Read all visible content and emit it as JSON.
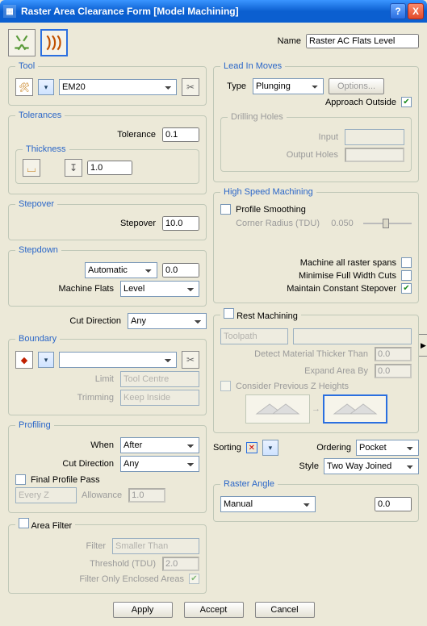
{
  "window": {
    "title": "Raster Area Clearance Form [Model Machining]",
    "help": "?",
    "close": "X"
  },
  "name": {
    "label": "Name",
    "value": "Raster AC Flats Level"
  },
  "tool": {
    "legend": "Tool",
    "value": "EM20"
  },
  "tolerances": {
    "legend": "Tolerances",
    "tolerance_label": "Tolerance",
    "tolerance_value": "0.1",
    "thickness_legend": "Thickness",
    "thickness_value": "1.0"
  },
  "stepover": {
    "legend": "Stepover",
    "label": "Stepover",
    "value": "10.0"
  },
  "stepdown": {
    "legend": "Stepdown",
    "mode": "Automatic",
    "value": "0.0",
    "mflats_label": "Machine Flats",
    "mflats_value": "Level"
  },
  "cutdir": {
    "label": "Cut Direction",
    "value": "Any"
  },
  "boundary": {
    "legend": "Boundary",
    "value": "",
    "limit_label": "Limit",
    "limit_value": "Tool Centre",
    "trim_label": "Trimming",
    "trim_value": "Keep Inside"
  },
  "profiling": {
    "legend": "Profiling",
    "when_label": "When",
    "when_value": "After",
    "cutdir_label": "Cut Direction",
    "cutdir_value": "Any",
    "final_label": "Final Profile Pass",
    "every_value": "Every Z",
    "allow_label": "Allowance",
    "allow_value": "1.0"
  },
  "areafilter": {
    "legend": "Area Filter",
    "filter_label": "Filter",
    "filter_value": "Smaller Than",
    "thresh_label": "Threshold (TDU)",
    "thresh_value": "2.0",
    "enclosed_label": "Filter Only Enclosed Areas"
  },
  "leadin": {
    "legend": "Lead In Moves",
    "type_label": "Type",
    "type_value": "Plunging",
    "options_label": "Options...",
    "approach_label": "Approach Outside",
    "drill_legend": "Drilling Holes",
    "input_label": "Input",
    "output_label": "Output Holes"
  },
  "hsm": {
    "legend": "High Speed Machining",
    "prof_label": "Profile Smoothing",
    "corner_label": "Corner Radius (TDU)",
    "corner_value": "0.050",
    "mall_label": "Machine all raster spans",
    "minfull_label": "Minimise Full Width Cuts",
    "maint_label": "Maintain Constant Stepover"
  },
  "rest": {
    "legend": "Rest Machining",
    "tp_label": "Toolpath",
    "detect_label": "Detect Material Thicker Than",
    "detect_value": "0.0",
    "expand_label": "Expand Area By",
    "expand_value": "0.0",
    "consider_label": "Consider Previous Z Heights"
  },
  "sort": {
    "label": "Sorting",
    "order_label": "Ordering",
    "order_value": "Pocket",
    "style_label": "Style",
    "style_value": "Two Way Joined"
  },
  "raster": {
    "legend": "Raster Angle",
    "mode": "Manual",
    "value": "0.0"
  },
  "footer": {
    "apply": "Apply",
    "accept": "Accept",
    "cancel": "Cancel"
  }
}
